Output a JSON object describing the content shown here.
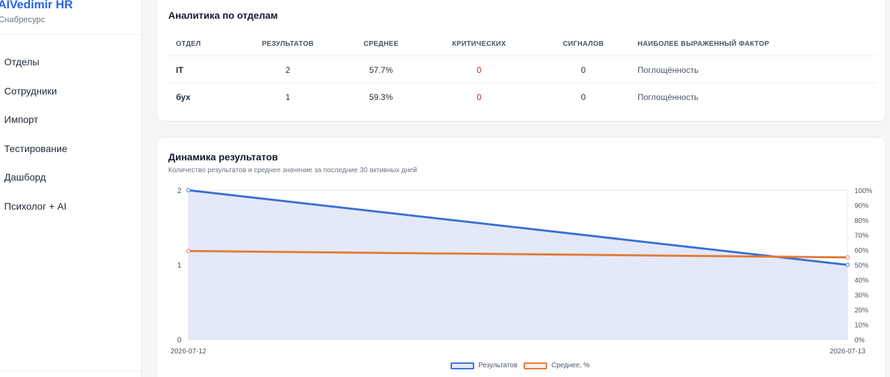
{
  "app": {
    "brand": "AIVedimir HR",
    "subtitle": "Снабресурс"
  },
  "sidebar": {
    "items": [
      {
        "label": "Отделы"
      },
      {
        "label": "Сотрудники"
      },
      {
        "label": "Импорт"
      },
      {
        "label": "Тестирование"
      },
      {
        "label": "Дашборд"
      },
      {
        "label": "Психолог + AI"
      }
    ]
  },
  "analytics": {
    "title": "Аналитика по отделам",
    "columns": [
      "ОТДЕЛ",
      "РЕЗУЛЬТАТОВ",
      "СРЕДНЕЕ",
      "КРИТИЧЕСКИХ",
      "СИГНАЛОВ",
      "НАИБОЛЕЕ ВЫРАЖЕННЫЙ ФАКТОР"
    ],
    "rows": [
      {
        "dept": "IT",
        "results": "2",
        "average": "57.7%",
        "critical": "0",
        "signals": "0",
        "factor": "Поглощённость"
      },
      {
        "dept": "бух",
        "results": "1",
        "average": "59.3%",
        "critical": "0",
        "signals": "0",
        "factor": "Поглощённость"
      }
    ]
  },
  "dynamics": {
    "title": "Динамика результатов",
    "subtitle": "Количество результатов и среднее значение за последние 30 активных дней"
  },
  "chart_data": {
    "type": "line",
    "x": [
      "2026-07-12",
      "2026-07-13"
    ],
    "series": [
      {
        "name": "Результатов",
        "values": [
          2,
          1
        ],
        "axis": "left",
        "color": "#3b6fd4",
        "fill": "#e3e9f9"
      },
      {
        "name": "Среднее, %",
        "values": [
          59.3,
          55.0
        ],
        "axis": "right",
        "color": "#e07b39"
      }
    ],
    "y_left": {
      "range": [
        0,
        2
      ],
      "ticks": [
        "0",
        "1",
        "2"
      ]
    },
    "y_right": {
      "range": [
        0,
        100
      ],
      "ticks": [
        "0%",
        "10%",
        "20%",
        "30%",
        "40%",
        "50%",
        "60%",
        "70%",
        "80%",
        "90%",
        "100%"
      ]
    },
    "grid": true,
    "legend": "bottom-center"
  }
}
